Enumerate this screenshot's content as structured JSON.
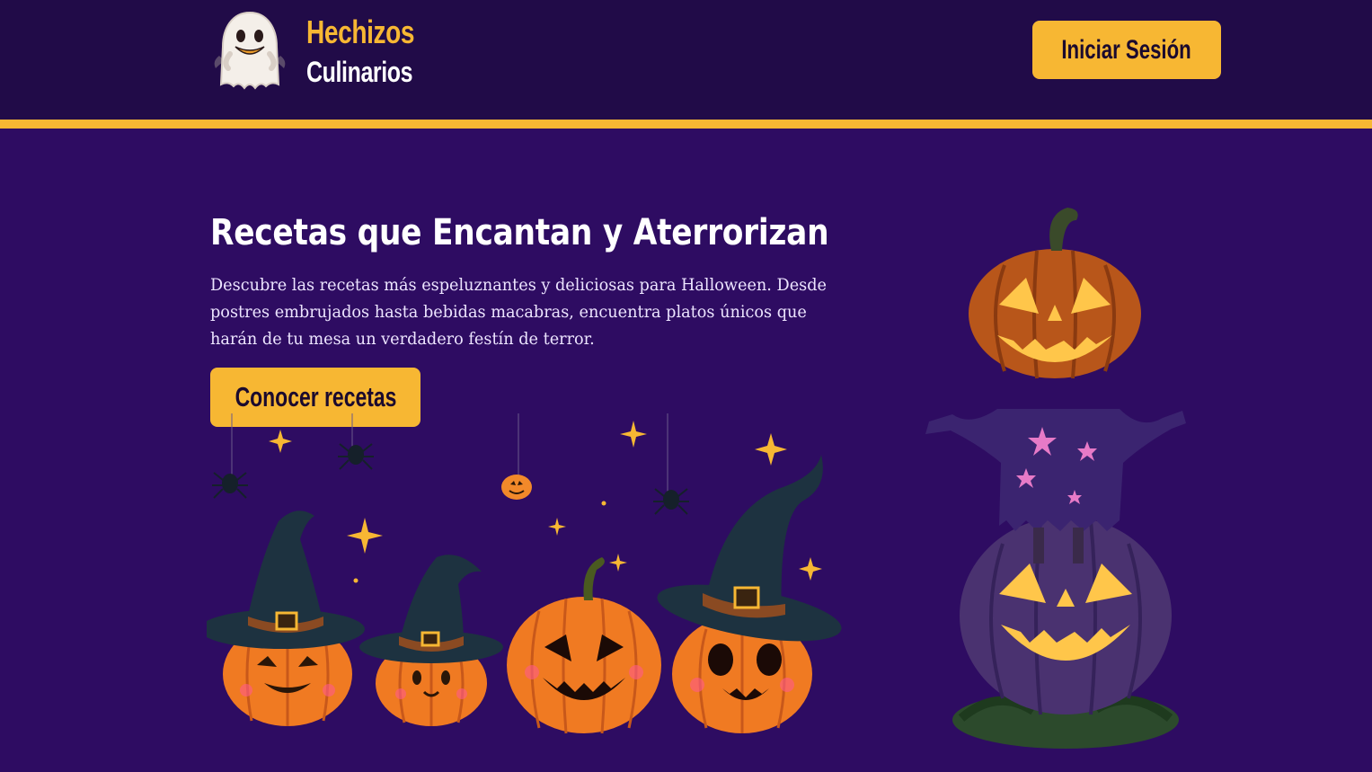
{
  "header": {
    "logo_line1": "Hechizos",
    "logo_line2": "Culinarios",
    "login_label": "Iniciar Sesión"
  },
  "hero": {
    "title": "Recetas que Encantan y Aterrorizan",
    "description": "Descubre las recetas más espeluznantes y deliciosas para Halloween. Desde postres embrujados hasta bebidas macabras, encuentra platos únicos que harán de tu mesa un verdadero festín de terror.",
    "cta_label": "Conocer recetas"
  },
  "icons": {
    "logo": "ghost-icon",
    "left_illustration": "witch-hat-pumpkins-illustration",
    "right_illustration": "pumpkin-scarecrow-illustration"
  },
  "colors": {
    "background": "#2e0c62",
    "header": "#210b48",
    "accent": "#f7b733",
    "text": "#ffffff"
  }
}
